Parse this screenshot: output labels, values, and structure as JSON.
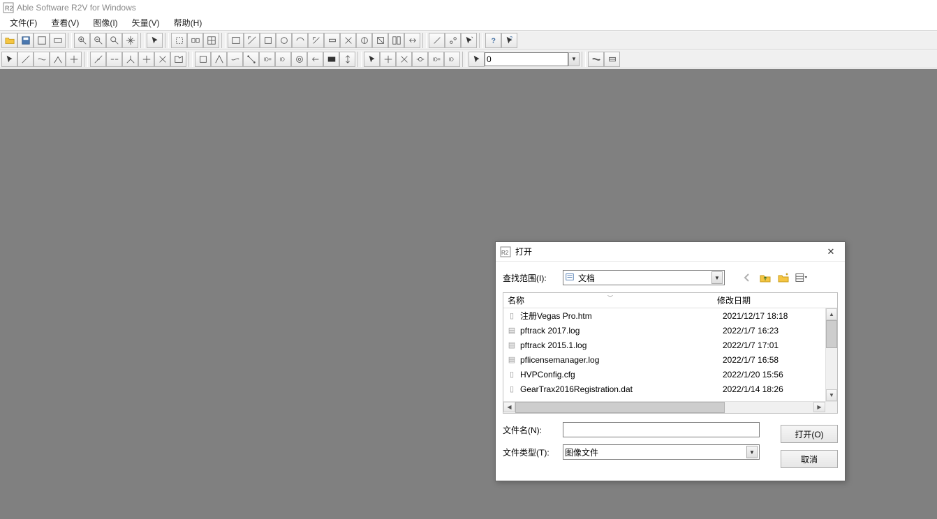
{
  "app": {
    "title": "Able Software R2V for Windows"
  },
  "menu": {
    "items": [
      "文件(F)",
      "查看(V)",
      "图像(I)",
      "矢量(V)",
      "帮助(H)"
    ]
  },
  "toolbar2": {
    "number_value": "0"
  },
  "dialog": {
    "title": "打开",
    "lookin_label": "查找范围(I):",
    "lookin_value": "文档",
    "columns": {
      "name": "名称",
      "date": "修改日期"
    },
    "files": [
      {
        "name": "注册Vegas Pro.htm",
        "date": "2021/12/17 18:18"
      },
      {
        "name": "pftrack 2017.log",
        "date": "2022/1/7 16:23"
      },
      {
        "name": "pftrack 2015.1.log",
        "date": "2022/1/7 17:01"
      },
      {
        "name": "pflicensemanager.log",
        "date": "2022/1/7 16:58"
      },
      {
        "name": "HVPConfig.cfg",
        "date": "2022/1/20 15:56"
      },
      {
        "name": "GearTrax2016Registration.dat",
        "date": "2022/1/14 18:26"
      }
    ],
    "filename_label": "文件名(N):",
    "filename_value": "",
    "filetype_label": "文件类型(T):",
    "filetype_value": "图像文件",
    "open_button": "打开(O)",
    "cancel_button": "取消"
  }
}
